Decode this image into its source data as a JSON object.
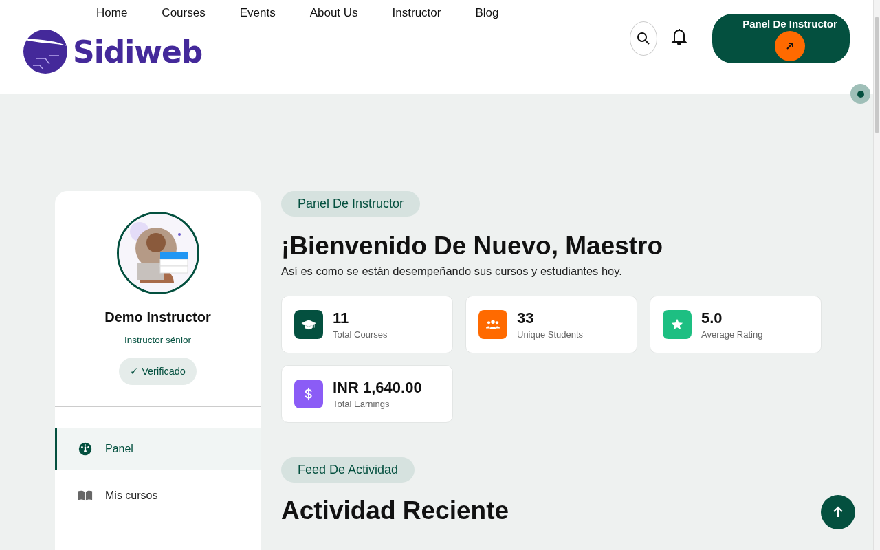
{
  "nav": {
    "links": [
      {
        "label": "Home"
      },
      {
        "label": "Courses"
      },
      {
        "label": "Events"
      },
      {
        "label": "About Us"
      },
      {
        "label": "Instructor"
      },
      {
        "label": "Blog"
      }
    ]
  },
  "logo": {
    "text": "Sidiweb"
  },
  "header_button": {
    "label": "Panel De Instructor"
  },
  "profile": {
    "name": "Demo Instructor",
    "role": "Instructor sénior",
    "badge": "✓ Verificado"
  },
  "sidebar": {
    "items": [
      {
        "label": "Panel",
        "kind": "dashboard",
        "selected": true
      },
      {
        "label": "Mis cursos",
        "kind": "book",
        "selected": false
      }
    ]
  },
  "dashboard": {
    "eyebrow": "Panel De Instructor",
    "title": "¡Bienvenido De Nuevo, Maestro",
    "subtitle": "Así es como se están desempeñando sus cursos y estudiantes hoy.",
    "stats": [
      {
        "value": "11",
        "label": "Total Courses",
        "kind": "courses",
        "color": "#04503f"
      },
      {
        "value": "33",
        "label": "Unique Students",
        "kind": "students",
        "color": "#ff6a00"
      },
      {
        "value": "5.0",
        "label": "Average Rating",
        "kind": "rating",
        "color": "#1dbf82"
      },
      {
        "value": "INR 1,640.00",
        "label": "Total Earnings",
        "kind": "earnings",
        "color": "#8b5cf6"
      }
    ]
  },
  "activity": {
    "eyebrow": "Feed De Actividad",
    "title": "Actividad Reciente"
  }
}
